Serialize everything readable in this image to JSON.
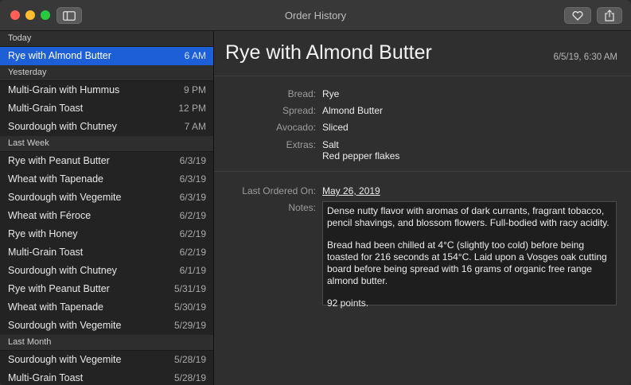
{
  "window": {
    "title": "Order History"
  },
  "sidebar": {
    "sections": [
      {
        "header": "Today",
        "items": [
          {
            "name": "Rye with Almond Butter",
            "time": "6 AM",
            "selected": true
          }
        ]
      },
      {
        "header": "Yesterday",
        "items": [
          {
            "name": "Multi-Grain with Hummus",
            "time": "9 PM"
          },
          {
            "name": "Multi-Grain Toast",
            "time": "12 PM"
          },
          {
            "name": "Sourdough with Chutney",
            "time": "7 AM"
          }
        ]
      },
      {
        "header": "Last Week",
        "items": [
          {
            "name": "Rye with Peanut Butter",
            "time": "6/3/19"
          },
          {
            "name": "Wheat with Tapenade",
            "time": "6/3/19"
          },
          {
            "name": "Sourdough with Vegemite",
            "time": "6/3/19"
          },
          {
            "name": "Wheat with Féroce",
            "time": "6/2/19"
          },
          {
            "name": "Rye with Honey",
            "time": "6/2/19"
          },
          {
            "name": "Multi-Grain Toast",
            "time": "6/2/19"
          },
          {
            "name": "Sourdough with Chutney",
            "time": "6/1/19"
          },
          {
            "name": "Rye with Peanut Butter",
            "time": "5/31/19"
          },
          {
            "name": "Wheat with Tapenade",
            "time": "5/30/19"
          },
          {
            "name": "Sourdough with Vegemite",
            "time": "5/29/19"
          }
        ]
      },
      {
        "header": "Last Month",
        "items": [
          {
            "name": "Sourdough with Vegemite",
            "time": "5/28/19"
          },
          {
            "name": "Multi-Grain Toast",
            "time": "5/28/19"
          }
        ]
      }
    ]
  },
  "detail": {
    "title": "Rye with Almond Butter",
    "date": "6/5/19, 6:30 AM",
    "fields": {
      "bread_label": "Bread:",
      "bread": "Rye",
      "spread_label": "Spread:",
      "spread": "Almond Butter",
      "avocado_label": "Avocado:",
      "avocado": "Sliced",
      "extras_label": "Extras:",
      "extras_1": "Salt",
      "extras_2": "Red pepper flakes"
    },
    "last_ordered_label": "Last Ordered On:",
    "last_ordered": "May 26, 2019",
    "notes_label": "Notes:",
    "notes": [
      "Dense nutty flavor with aromas of dark currants, fragrant tobacco, pencil shavings, and blossom flowers. Full-bodied with racy acidity.",
      "Bread had been chilled at 4°C (slightly too cold) before being toasted for 216 seconds at 154°C. Laid upon a Vosges oak cutting board before being spread with 16 grams of organic free range almond butter.",
      "92 points."
    ]
  }
}
